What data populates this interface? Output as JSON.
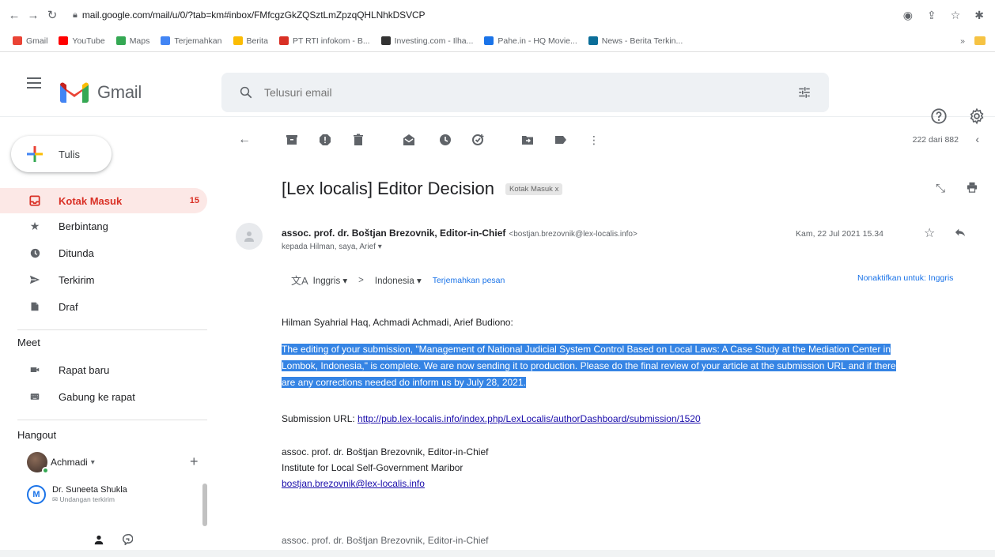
{
  "browser": {
    "url": "mail.google.com/mail/u/0/?tab=km#inbox/FMfcgzGkZQSztLmZpzqQHLNhkDSVCP",
    "bookmarks": [
      {
        "label": "Gmail",
        "color": "#ea4335"
      },
      {
        "label": "YouTube",
        "color": "#ff0000"
      },
      {
        "label": "Maps",
        "color": "#34a853"
      },
      {
        "label": "Terjemahkan",
        "color": "#4285f4"
      },
      {
        "label": "Berita",
        "color": "#fbbc04"
      },
      {
        "label": "PT RTI infokom - B...",
        "color": "#d93025"
      },
      {
        "label": "Investing.com - Ilha...",
        "color": "#333333"
      },
      {
        "label": "Pahe.in - HQ Movie...",
        "color": "#1a73e8"
      },
      {
        "label": "News - Berita Terkin...",
        "color": "#0b6e99"
      }
    ]
  },
  "header": {
    "app_name": "Gmail",
    "search_placeholder": "Telusuri email"
  },
  "sidebar": {
    "compose_label": "Tulis",
    "items": [
      {
        "label": "Kotak Masuk",
        "count": "15",
        "icon": "inbox-icon"
      },
      {
        "label": "Berbintang",
        "count": "",
        "icon": "star-icon"
      },
      {
        "label": "Ditunda",
        "count": "",
        "icon": "clock-icon"
      },
      {
        "label": "Terkirim",
        "count": "",
        "icon": "send-icon"
      },
      {
        "label": "Draf",
        "count": "",
        "icon": "draft-icon"
      }
    ],
    "meet": {
      "title": "Meet",
      "new_meeting": "Rapat baru",
      "join_meeting": "Gabung ke rapat"
    },
    "hangout": {
      "title": "Hangout",
      "me": "Achmadi",
      "contact_name": "Dr. Suneeta Shukla",
      "contact_status": "Undangan terkirim"
    }
  },
  "toolbar": {
    "counter": "222 dari 882"
  },
  "email": {
    "subject": "[Lex localis] Editor Decision",
    "label_chip": "Kotak Masuk x",
    "sender_name": "assoc. prof. dr. Boštjan Brezovnik, Editor-in-Chief",
    "sender_email": "<bostjan.brezovnik@lex-localis.info>",
    "recipients": "kepada Hilman, saya, Arief ▾",
    "date": "Kam, 22 Jul 2021 15.34",
    "translate": {
      "from": "Inggris ▾",
      "arrow": ">",
      "to": "Indonesia ▾",
      "action": "Terjemahkan pesan",
      "disable": "Nonaktifkan untuk: Inggris"
    },
    "greeting": "Hilman Syahrial Haq, Achmadi Achmadi, Arief Budiono:",
    "body_lines": [
      "The editing of your submission, \"Management of National Judicial System Control Based on Local Laws: A Case Study at the Mediation Center in",
      "Lombok, Indonesia,\" is complete. We are now sending it to production. Please do the final review of your article at the submission URL and if there",
      "are any corrections needed do inform us by July 28, 2021."
    ],
    "submission_label": "Submission URL:",
    "submission_url": "http://pub.lex-localis.info/index.php/LexLocalis/authorDashboard/submission/1520",
    "signature": {
      "name": "assoc. prof. dr. Boštjan Brezovnik, Editor-in-Chief",
      "institute": "Institute for Local Self-Government Maribor",
      "email": "bostjan.brezovnik@lex-localis.info"
    },
    "signature_repeat": "assoc. prof. dr. Boštjan Brezovnik, Editor-in-Chief"
  }
}
